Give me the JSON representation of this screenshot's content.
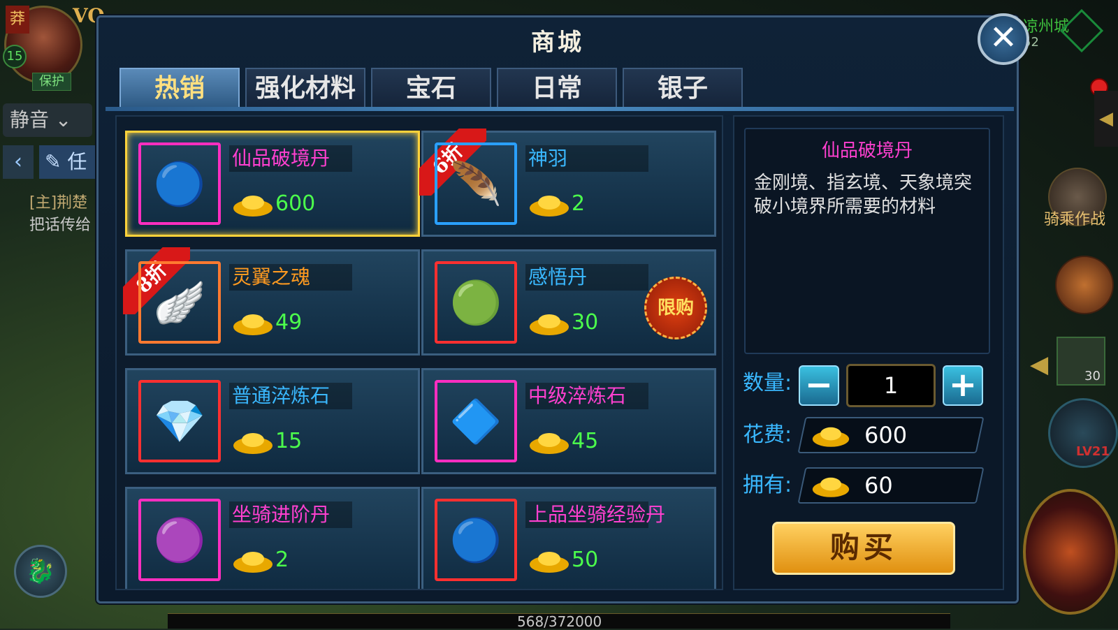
{
  "hud": {
    "player_level": "15",
    "name_badge": "莽",
    "vip_label": "VO",
    "protect_label": "保护",
    "mute_label": "静音",
    "task_label": "任",
    "chat_line1": "[主]荆楚",
    "chat_line2": "把话传给",
    "city_name": "凉州城",
    "time_text": "52",
    "mount_battle_label": "骑乘作战",
    "item_count": "30",
    "lock_level": "LV21",
    "exp_text": "568/372000"
  },
  "shop": {
    "title": "商城",
    "close_label": "✕",
    "tabs": [
      {
        "label": "热销",
        "active": true
      },
      {
        "label": "强化材料",
        "active": false
      },
      {
        "label": "宝石",
        "active": false
      },
      {
        "label": "日常",
        "active": false
      },
      {
        "label": "银子",
        "active": false
      }
    ],
    "items": [
      {
        "name": "仙品破境丹",
        "price": "600",
        "name_color": "pink",
        "icon": "orb-cluster-icon",
        "selected": true
      },
      {
        "name": "神羽",
        "price": "2",
        "name_color": "cyan",
        "icon": "feather-icon",
        "ribbon": "6折"
      },
      {
        "name": "灵翼之魂",
        "price": "49",
        "name_color": "orange",
        "icon": "wings-icon",
        "ribbon": "8折"
      },
      {
        "name": "感悟丹",
        "price": "30",
        "name_color": "cyan",
        "icon": "green-orb-icon",
        "badge": "限购"
      },
      {
        "name": "普通淬炼石",
        "price": "15",
        "name_color": "cyan",
        "icon": "blue-crystal-icon"
      },
      {
        "name": "中级淬炼石",
        "price": "45",
        "name_color": "pink",
        "icon": "teal-gem-icon"
      },
      {
        "name": "坐骑进阶丹",
        "price": "2",
        "name_color": "pink",
        "icon": "pink-orb-icon"
      },
      {
        "name": "上品坐骑经验丹",
        "price": "50",
        "name_color": "pink",
        "icon": "blue-orb-icon"
      }
    ],
    "detail": {
      "title": "仙品破境丹",
      "description": "金刚境、指玄境、天象境突破小境界所需要的材料",
      "qty_label": "数量:",
      "qty_value": "1",
      "cost_label": "花费:",
      "cost_value": "600",
      "own_label": "拥有:",
      "own_value": "60",
      "buy_label": "购买"
    }
  },
  "colors": {
    "accent": "#ffd23a",
    "price_green": "#4cff4c",
    "name_pink": "#ff40d0",
    "name_cyan": "#3ab8ff"
  }
}
